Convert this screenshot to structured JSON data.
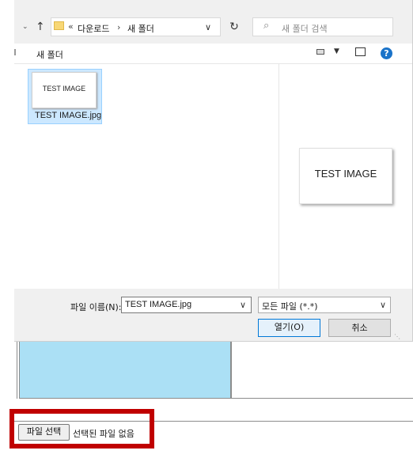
{
  "nav": {
    "down_icon": "chevron-down",
    "up_icon": "arrow-up"
  },
  "address": {
    "folder_icon": "folder",
    "overflow": "«",
    "crumbs": [
      "다운로드",
      "새 폴더"
    ],
    "separator": "›",
    "chevron": "∨"
  },
  "refresh_icon": "↻",
  "search": {
    "icon": "⌕",
    "placeholder": "새 폴더 검색"
  },
  "current_folder": "새 폴더",
  "toolbar": {
    "view_chevron": "▼",
    "help": "?"
  },
  "files": [
    {
      "thumb_text": "TEST IMAGE",
      "name": "TEST IMAGE.jpg"
    }
  ],
  "preview_text": "TEST IMAGE",
  "footer": {
    "filename_label": "파일 이름(N):",
    "filename_value": "TEST IMAGE.jpg",
    "filename_chevron": "∨",
    "type_value": "모든 파일 (*.*)",
    "type_chevron": "∨",
    "open_label": "열기(O)",
    "cancel_label": "취소"
  },
  "page": {
    "file_button": "파일 선택",
    "no_file_text": "선택된 파일 없음"
  }
}
